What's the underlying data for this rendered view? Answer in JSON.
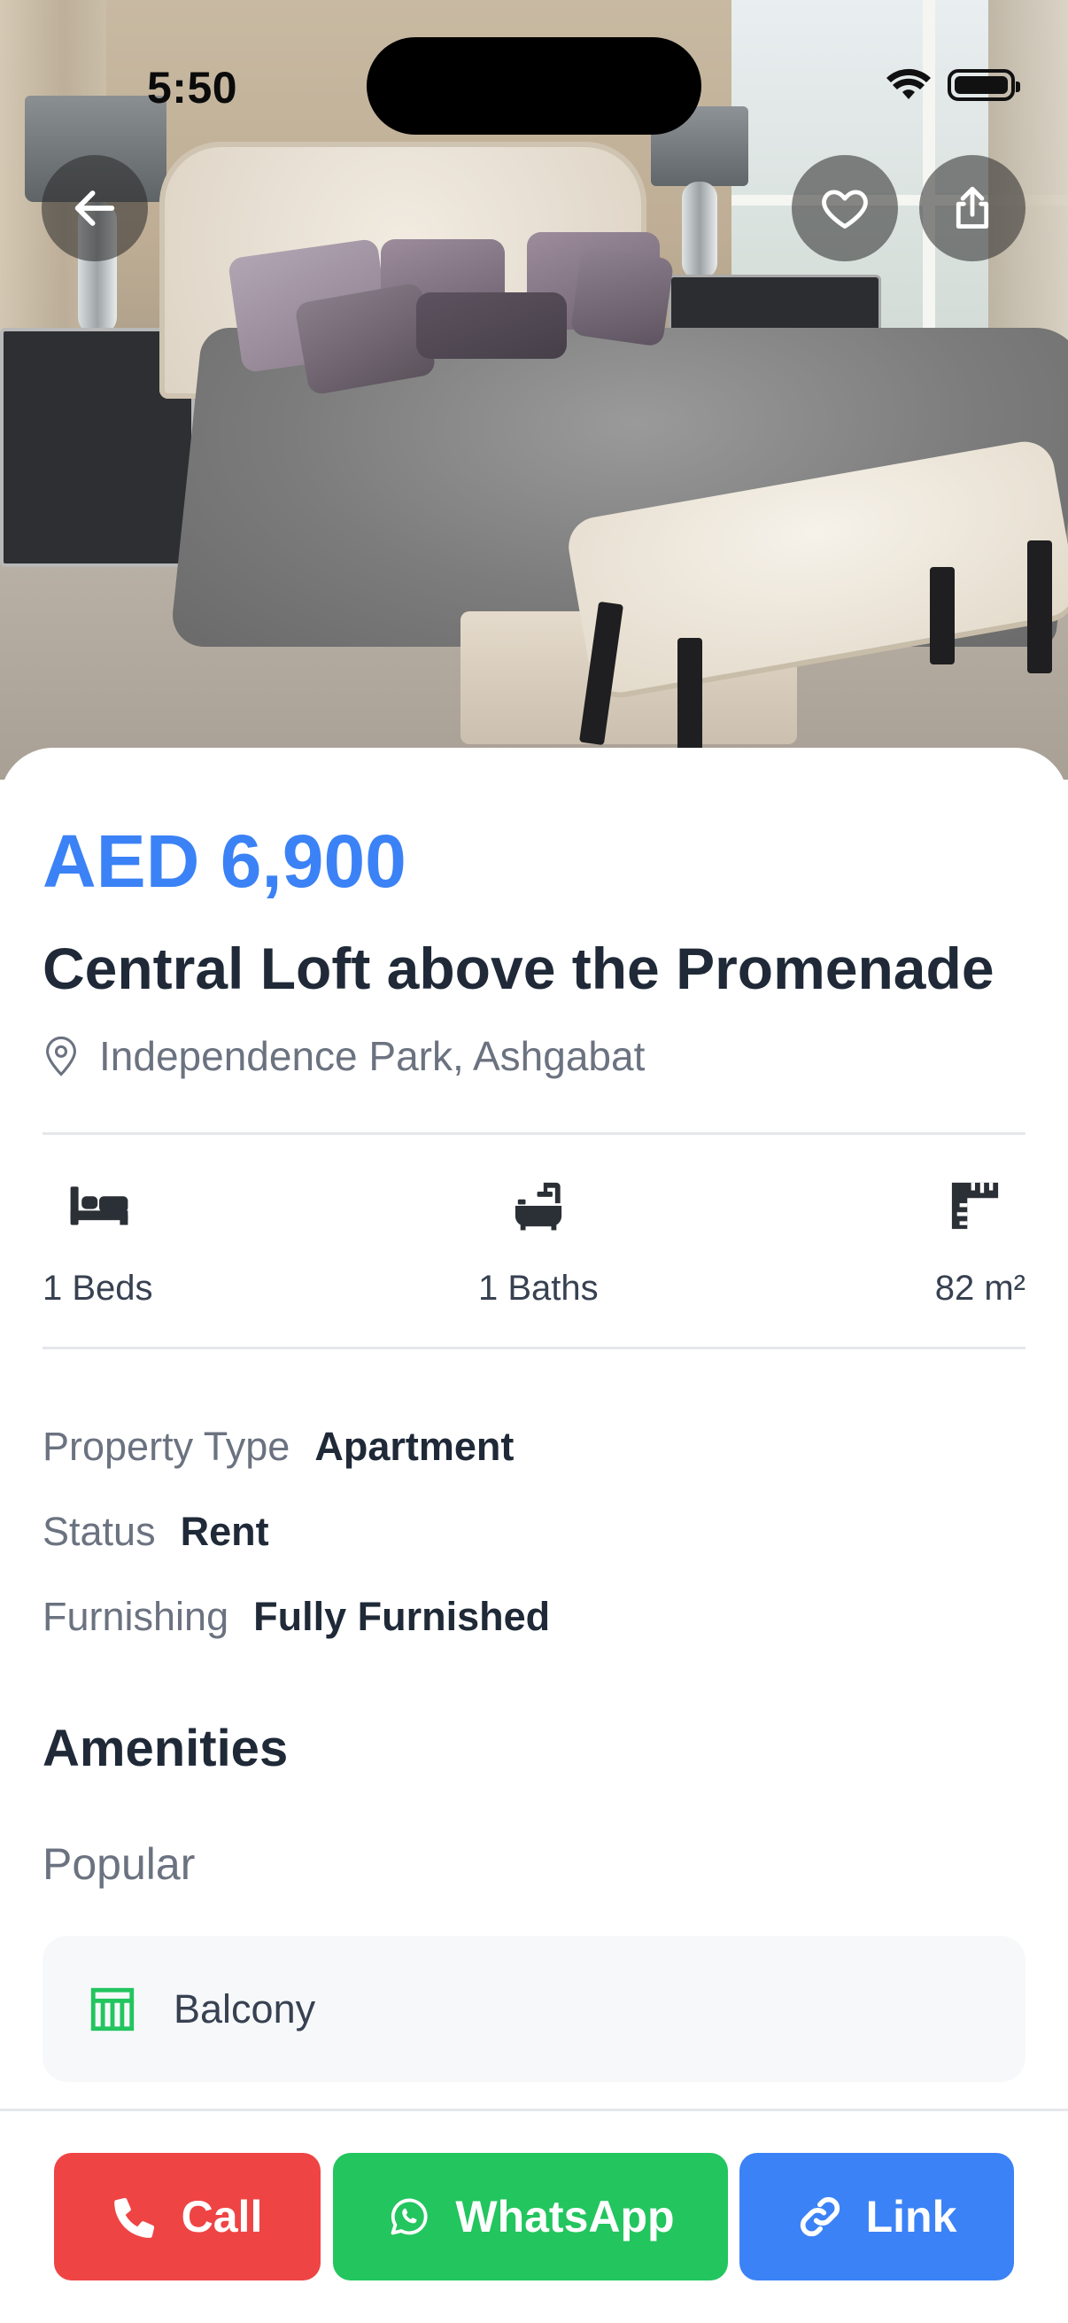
{
  "status_bar": {
    "time": "5:50"
  },
  "hero": {
    "back_icon": "arrow-left-icon",
    "favorite_icon": "heart-icon",
    "share_icon": "share-icon"
  },
  "listing": {
    "price": "AED 6,900",
    "title": "Central Loft above the Promenade",
    "location": "Independence Park, Ashgabat"
  },
  "stats": {
    "beds": "1 Beds",
    "baths": "1 Baths",
    "area": "82 m²"
  },
  "details": [
    {
      "label": "Property Type",
      "value": "Apartment"
    },
    {
      "label": "Status",
      "value": "Rent"
    },
    {
      "label": "Furnishing",
      "value": "Fully Furnished"
    }
  ],
  "amenities": {
    "heading": "Amenities",
    "group": "Popular",
    "items": [
      {
        "label": "Balcony",
        "icon": "balcony-icon"
      }
    ]
  },
  "actions": {
    "call": "Call",
    "whatsapp": "WhatsApp",
    "link": "Link"
  },
  "colors": {
    "accent": "#3b82f6",
    "call": "#ef4444",
    "whatsapp": "#22c55e",
    "link": "#3b82f6",
    "amenity_icon": "#22c55e"
  }
}
